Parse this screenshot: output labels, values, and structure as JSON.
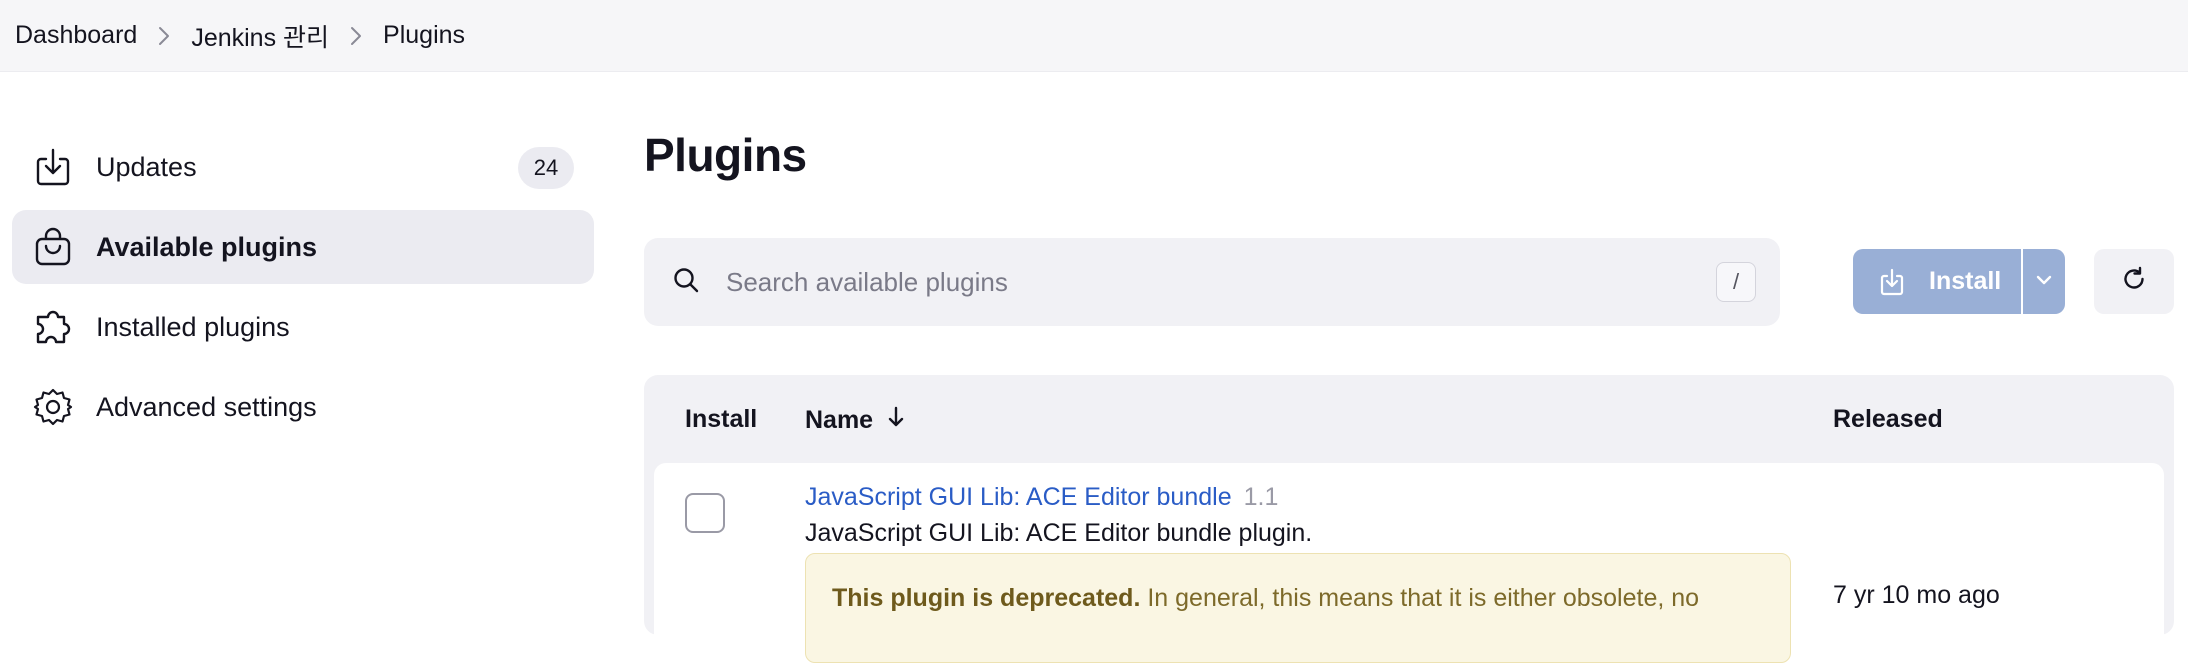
{
  "breadcrumb": {
    "items": [
      "Dashboard",
      "Jenkins 관리",
      "Plugins"
    ]
  },
  "sidebar": {
    "items": [
      {
        "label": "Updates",
        "badge": "24",
        "icon": "download-icon",
        "active": false
      },
      {
        "label": "Available plugins",
        "icon": "shopping-bag-icon",
        "active": true
      },
      {
        "label": "Installed plugins",
        "icon": "puzzle-piece-icon",
        "active": false
      },
      {
        "label": "Advanced settings",
        "icon": "gear-icon",
        "active": false
      }
    ]
  },
  "main": {
    "title": "Plugins",
    "search": {
      "placeholder": "Search available plugins",
      "shortcut": "/"
    },
    "install_button": "Install",
    "table": {
      "headers": {
        "install": "Install",
        "name": "Name",
        "released": "Released"
      },
      "rows": [
        {
          "name": "JavaScript GUI Lib: ACE Editor bundle",
          "version": "1.1",
          "description": "JavaScript GUI Lib: ACE Editor bundle plugin.",
          "released": "7 yr 10 mo ago",
          "deprecated_title": "This plugin is deprecated.",
          "deprecated_text": "In general, this means that it is either obsolete, no"
        }
      ]
    }
  },
  "colors": {
    "accent": "#2a5cc6",
    "install_disabled": "#99afd6",
    "sidebar_active": "#ebebf1",
    "warning_bg": "#faf6e3"
  }
}
